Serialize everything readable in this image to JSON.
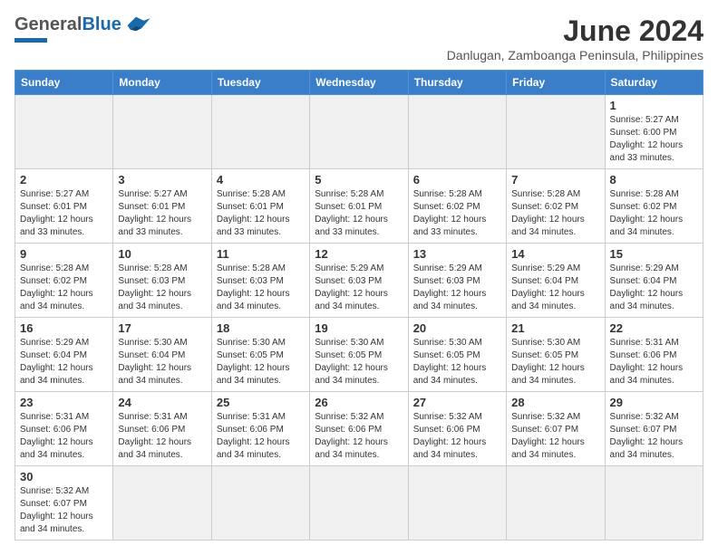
{
  "header": {
    "title": "June 2024",
    "subtitle": "Danlugan, Zamboanga Peninsula, Philippines",
    "logo_general": "General",
    "logo_blue": "Blue"
  },
  "weekdays": [
    "Sunday",
    "Monday",
    "Tuesday",
    "Wednesday",
    "Thursday",
    "Friday",
    "Saturday"
  ],
  "weeks": [
    [
      {
        "day": "",
        "info": "",
        "empty": true
      },
      {
        "day": "",
        "info": "",
        "empty": true
      },
      {
        "day": "",
        "info": "",
        "empty": true
      },
      {
        "day": "",
        "info": "",
        "empty": true
      },
      {
        "day": "",
        "info": "",
        "empty": true
      },
      {
        "day": "",
        "info": "",
        "empty": true
      },
      {
        "day": "1",
        "info": "Sunrise: 5:27 AM\nSunset: 6:00 PM\nDaylight: 12 hours\nand 33 minutes."
      }
    ],
    [
      {
        "day": "2",
        "info": "Sunrise: 5:27 AM\nSunset: 6:01 PM\nDaylight: 12 hours\nand 33 minutes."
      },
      {
        "day": "3",
        "info": "Sunrise: 5:27 AM\nSunset: 6:01 PM\nDaylight: 12 hours\nand 33 minutes."
      },
      {
        "day": "4",
        "info": "Sunrise: 5:28 AM\nSunset: 6:01 PM\nDaylight: 12 hours\nand 33 minutes."
      },
      {
        "day": "5",
        "info": "Sunrise: 5:28 AM\nSunset: 6:01 PM\nDaylight: 12 hours\nand 33 minutes."
      },
      {
        "day": "6",
        "info": "Sunrise: 5:28 AM\nSunset: 6:02 PM\nDaylight: 12 hours\nand 33 minutes."
      },
      {
        "day": "7",
        "info": "Sunrise: 5:28 AM\nSunset: 6:02 PM\nDaylight: 12 hours\nand 34 minutes."
      },
      {
        "day": "8",
        "info": "Sunrise: 5:28 AM\nSunset: 6:02 PM\nDaylight: 12 hours\nand 34 minutes."
      }
    ],
    [
      {
        "day": "9",
        "info": "Sunrise: 5:28 AM\nSunset: 6:02 PM\nDaylight: 12 hours\nand 34 minutes."
      },
      {
        "day": "10",
        "info": "Sunrise: 5:28 AM\nSunset: 6:03 PM\nDaylight: 12 hours\nand 34 minutes."
      },
      {
        "day": "11",
        "info": "Sunrise: 5:28 AM\nSunset: 6:03 PM\nDaylight: 12 hours\nand 34 minutes."
      },
      {
        "day": "12",
        "info": "Sunrise: 5:29 AM\nSunset: 6:03 PM\nDaylight: 12 hours\nand 34 minutes."
      },
      {
        "day": "13",
        "info": "Sunrise: 5:29 AM\nSunset: 6:03 PM\nDaylight: 12 hours\nand 34 minutes."
      },
      {
        "day": "14",
        "info": "Sunrise: 5:29 AM\nSunset: 6:04 PM\nDaylight: 12 hours\nand 34 minutes."
      },
      {
        "day": "15",
        "info": "Sunrise: 5:29 AM\nSunset: 6:04 PM\nDaylight: 12 hours\nand 34 minutes."
      }
    ],
    [
      {
        "day": "16",
        "info": "Sunrise: 5:29 AM\nSunset: 6:04 PM\nDaylight: 12 hours\nand 34 minutes."
      },
      {
        "day": "17",
        "info": "Sunrise: 5:30 AM\nSunset: 6:04 PM\nDaylight: 12 hours\nand 34 minutes."
      },
      {
        "day": "18",
        "info": "Sunrise: 5:30 AM\nSunset: 6:05 PM\nDaylight: 12 hours\nand 34 minutes."
      },
      {
        "day": "19",
        "info": "Sunrise: 5:30 AM\nSunset: 6:05 PM\nDaylight: 12 hours\nand 34 minutes."
      },
      {
        "day": "20",
        "info": "Sunrise: 5:30 AM\nSunset: 6:05 PM\nDaylight: 12 hours\nand 34 minutes."
      },
      {
        "day": "21",
        "info": "Sunrise: 5:30 AM\nSunset: 6:05 PM\nDaylight: 12 hours\nand 34 minutes."
      },
      {
        "day": "22",
        "info": "Sunrise: 5:31 AM\nSunset: 6:06 PM\nDaylight: 12 hours\nand 34 minutes."
      }
    ],
    [
      {
        "day": "23",
        "info": "Sunrise: 5:31 AM\nSunset: 6:06 PM\nDaylight: 12 hours\nand 34 minutes."
      },
      {
        "day": "24",
        "info": "Sunrise: 5:31 AM\nSunset: 6:06 PM\nDaylight: 12 hours\nand 34 minutes."
      },
      {
        "day": "25",
        "info": "Sunrise: 5:31 AM\nSunset: 6:06 PM\nDaylight: 12 hours\nand 34 minutes."
      },
      {
        "day": "26",
        "info": "Sunrise: 5:32 AM\nSunset: 6:06 PM\nDaylight: 12 hours\nand 34 minutes."
      },
      {
        "day": "27",
        "info": "Sunrise: 5:32 AM\nSunset: 6:06 PM\nDaylight: 12 hours\nand 34 minutes."
      },
      {
        "day": "28",
        "info": "Sunrise: 5:32 AM\nSunset: 6:07 PM\nDaylight: 12 hours\nand 34 minutes."
      },
      {
        "day": "29",
        "info": "Sunrise: 5:32 AM\nSunset: 6:07 PM\nDaylight: 12 hours\nand 34 minutes."
      }
    ],
    [
      {
        "day": "30",
        "info": "Sunrise: 5:32 AM\nSunset: 6:07 PM\nDaylight: 12 hours\nand 34 minutes."
      },
      {
        "day": "",
        "info": "",
        "empty": true
      },
      {
        "day": "",
        "info": "",
        "empty": true
      },
      {
        "day": "",
        "info": "",
        "empty": true
      },
      {
        "day": "",
        "info": "",
        "empty": true
      },
      {
        "day": "",
        "info": "",
        "empty": true
      },
      {
        "day": "",
        "info": "",
        "empty": true
      }
    ]
  ]
}
